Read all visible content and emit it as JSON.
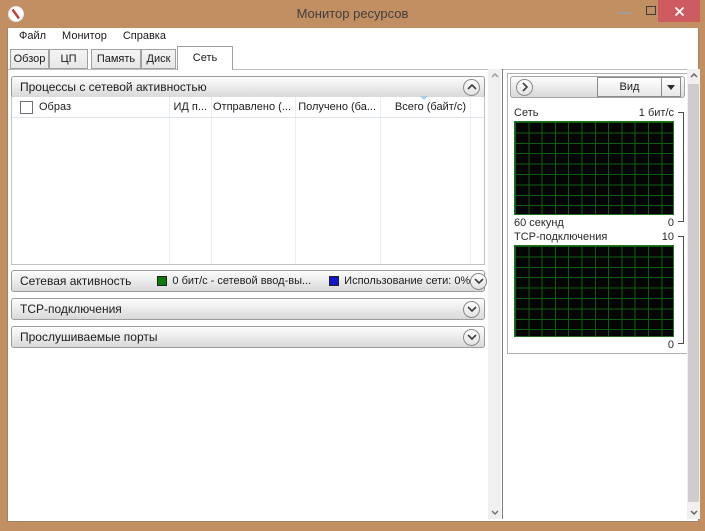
{
  "window": {
    "title": "Монитор ресурсов"
  },
  "menubar": {
    "items": [
      {
        "label": "Файл"
      },
      {
        "label": "Монитор"
      },
      {
        "label": "Справка"
      }
    ]
  },
  "tabs": [
    {
      "label": "Обзор"
    },
    {
      "label": "ЦП"
    },
    {
      "label": "Память"
    },
    {
      "label": "Диск"
    },
    {
      "label": "Сеть",
      "active": true
    }
  ],
  "processes_panel": {
    "title": "Процессы с сетевой активностью",
    "columns": [
      {
        "label": "Образ"
      },
      {
        "label": "ИД п..."
      },
      {
        "label": "Отправлено (..."
      },
      {
        "label": "Получено (ба..."
      },
      {
        "label": "Всего (байт/с)"
      }
    ],
    "rows": []
  },
  "sections": [
    {
      "title": "Сетевая активность",
      "legend": [
        {
          "color": "#0c7a0c",
          "label": "0 бит/с - сетевой ввод-вы..."
        },
        {
          "color": "#1414c8",
          "label": "Использование сети: 0%"
        }
      ]
    },
    {
      "title": "TCP-подключения"
    },
    {
      "title": "Прослушиваемые порты"
    }
  ],
  "right_panel": {
    "view_button_label": "Вид",
    "charts": [
      {
        "type": "area",
        "title": "Сеть",
        "scale_top": "1 бит/с",
        "scale_bottom": "0",
        "x_label": "60 секунд",
        "x_range_seconds": 60,
        "current_values": "flat zero (no activity)"
      },
      {
        "type": "area",
        "title": "TCP-подключения",
        "scale_top": "10",
        "scale_bottom": "0",
        "x_range_seconds": 60,
        "current_values": "flat zero (no activity)"
      }
    ]
  },
  "colors": {
    "frame": "#c28f63",
    "close_button": "#cd5b5f",
    "graph_background": "#050505",
    "graph_grid": "#0d5f0d",
    "legend_green": "#0c7a0c",
    "legend_blue": "#1414c8"
  }
}
